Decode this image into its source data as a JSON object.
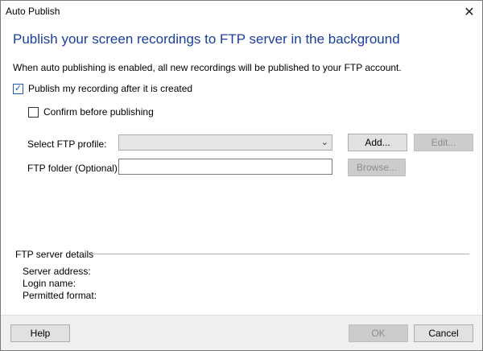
{
  "window": {
    "title": "Auto Publish",
    "close_glyph": "✕"
  },
  "heading": "Publish your screen recordings to FTP server in the background",
  "description": "When auto publishing is enabled, all new recordings will be published to your FTP account.",
  "options": {
    "publish_after_created": {
      "label": "Publish my recording after it is created",
      "checked": true
    },
    "confirm_before_publishing": {
      "label": "Confirm before publishing",
      "checked": false
    }
  },
  "form": {
    "ftp_profile_label": "Select FTP profile:",
    "ftp_profile_value": "",
    "ftp_folder_label": "FTP folder (Optional):",
    "ftp_folder_value": "",
    "add_label": "Add...",
    "edit_label": "Edit...",
    "browse_label": "Browse..."
  },
  "details": {
    "group_label": "FTP server details",
    "server_address_label": "Server address:",
    "login_name_label": "Login name:",
    "permitted_format_label": "Permitted format:"
  },
  "footer": {
    "help_label": "Help",
    "ok_label": "OK",
    "cancel_label": "Cancel"
  },
  "icons": {
    "check": "✓",
    "chevron": "⌄"
  },
  "colors": {
    "heading": "#1a3e9c",
    "checkbox_accent": "#1a5fb4"
  }
}
